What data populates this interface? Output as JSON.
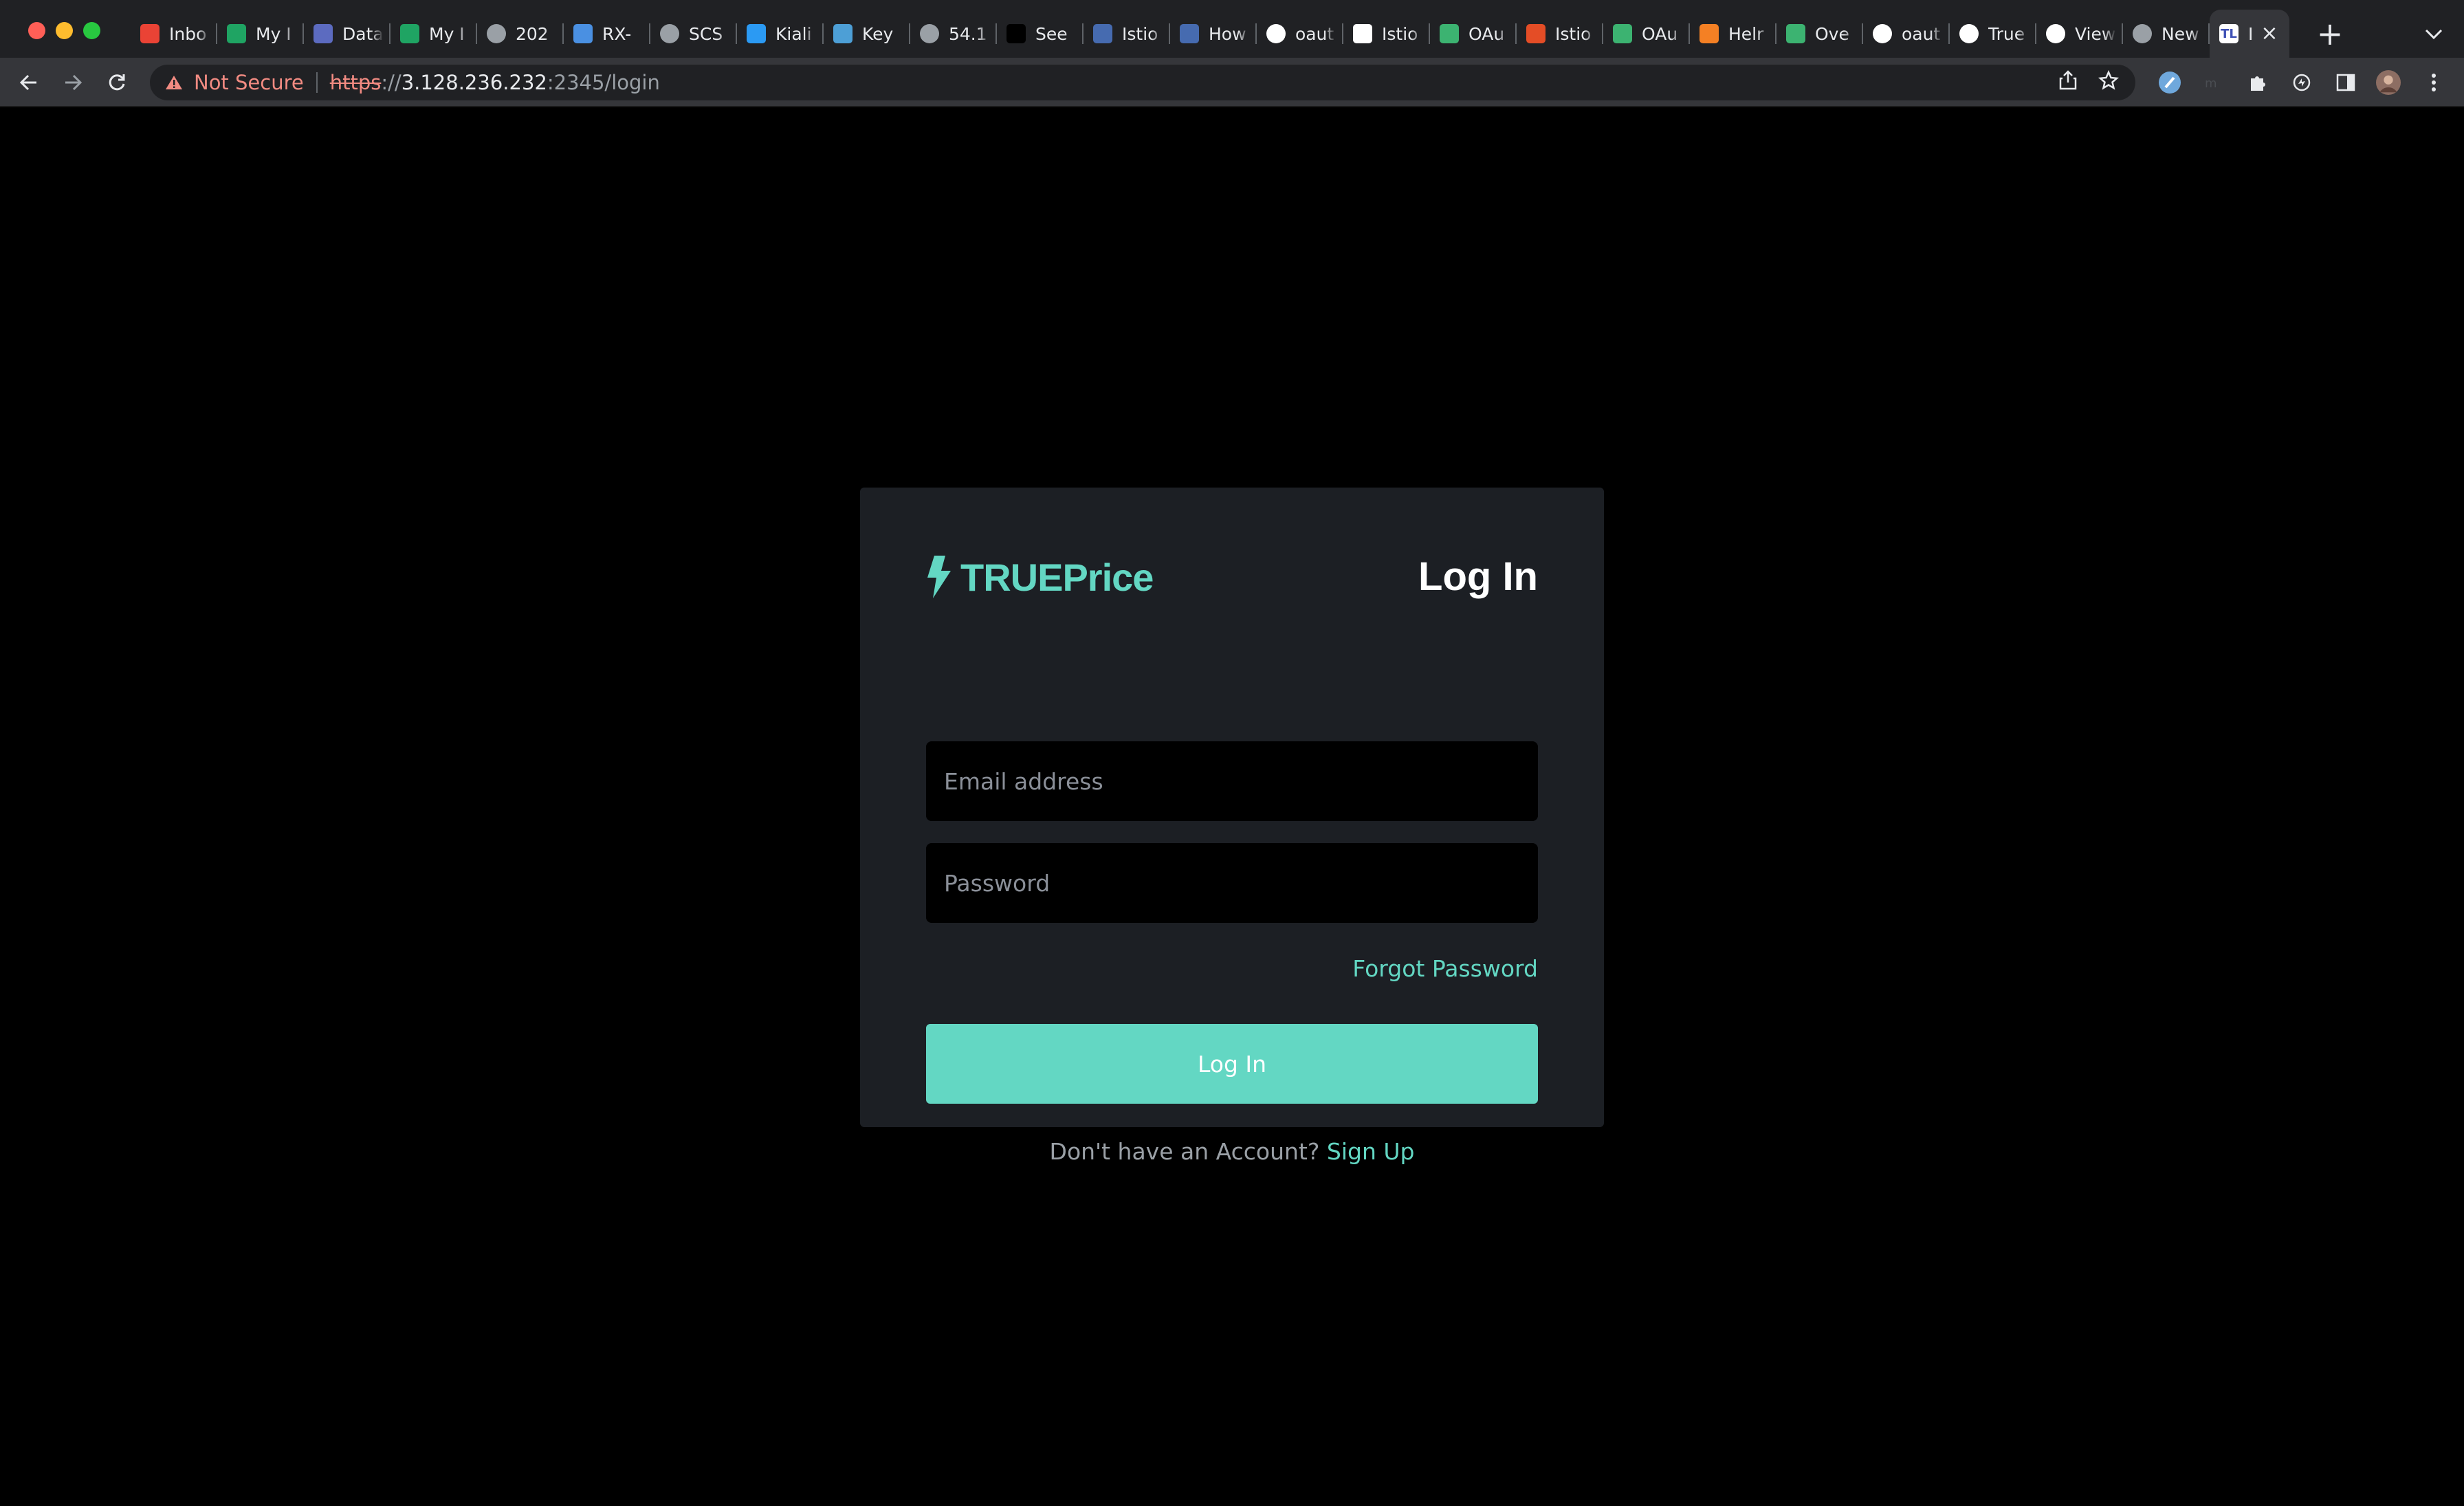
{
  "browser": {
    "tabs": [
      {
        "title": "Inbo",
        "favicon": "gmail-icon",
        "color": "#ea4335"
      },
      {
        "title": "My I",
        "favicon": "google-drive-icon",
        "color": "#1fa463"
      },
      {
        "title": "Data",
        "favicon": "data-icon",
        "color": "#5c6bc0"
      },
      {
        "title": "My I",
        "favicon": "google-drive-icon",
        "color": "#1fa463"
      },
      {
        "title": "202",
        "favicon": "globe-icon",
        "color": "#9aa0a6"
      },
      {
        "title": "RX-",
        "favicon": "doc-icon",
        "color": "#4a90e2"
      },
      {
        "title": "SCS",
        "favicon": "globe-icon",
        "color": "#9aa0a6"
      },
      {
        "title": "Kiali",
        "favicon": "kiali-icon",
        "color": "#2b9af3"
      },
      {
        "title": "Key",
        "favicon": "keycloak-icon",
        "color": "#4d9fd6"
      },
      {
        "title": "54.1",
        "favicon": "globe-icon",
        "color": "#9aa0a6"
      },
      {
        "title": "See",
        "favicon": "x-icon",
        "color": "#000000"
      },
      {
        "title": "Istio",
        "favicon": "istio-icon",
        "color": "#466bb0"
      },
      {
        "title": "How",
        "favicon": "istio-icon",
        "color": "#466bb0"
      },
      {
        "title": "oaut",
        "favicon": "github-icon",
        "color": "#ffffff"
      },
      {
        "title": "Istio",
        "favicon": "medium-icon",
        "color": "#ffffff"
      },
      {
        "title": "OAu",
        "favicon": "oauth-icon",
        "color": "#3cb371"
      },
      {
        "title": "Istio",
        "favicon": "vuetify-icon",
        "color": "#e44d26"
      },
      {
        "title": "OAu",
        "favicon": "oauth-icon",
        "color": "#3cb371"
      },
      {
        "title": "Helr",
        "favicon": "stack-icon",
        "color": "#f48024"
      },
      {
        "title": "Ove",
        "favicon": "oauth-icon",
        "color": "#3cb371"
      },
      {
        "title": "oaut",
        "favicon": "github-icon",
        "color": "#ffffff"
      },
      {
        "title": "True",
        "favicon": "github-icon",
        "color": "#ffffff"
      },
      {
        "title": "View",
        "favicon": "github-icon",
        "color": "#ffffff"
      },
      {
        "title": "New",
        "favicon": "chrome-icon",
        "color": "#9aa0a6"
      }
    ],
    "active_tab": {
      "title": "I",
      "favicon_text": "TL",
      "color": "#ffffff"
    },
    "security_label": "Not Secure",
    "url_scheme": "https",
    "url_sep": "://",
    "url_host": "3.128.236.232",
    "url_path": ":2345/login"
  },
  "login": {
    "brand": "TRUEPrice",
    "title": "Log In",
    "email_placeholder": "Email address",
    "password_placeholder": "Password",
    "forgot_label": "Forgot Password",
    "submit_label": "Log In",
    "signup_prompt": "Don't have an Account?",
    "signup_link": "Sign Up"
  },
  "colors": {
    "accent": "#63d7c3",
    "card": "#1c1f24",
    "background": "#000000"
  }
}
